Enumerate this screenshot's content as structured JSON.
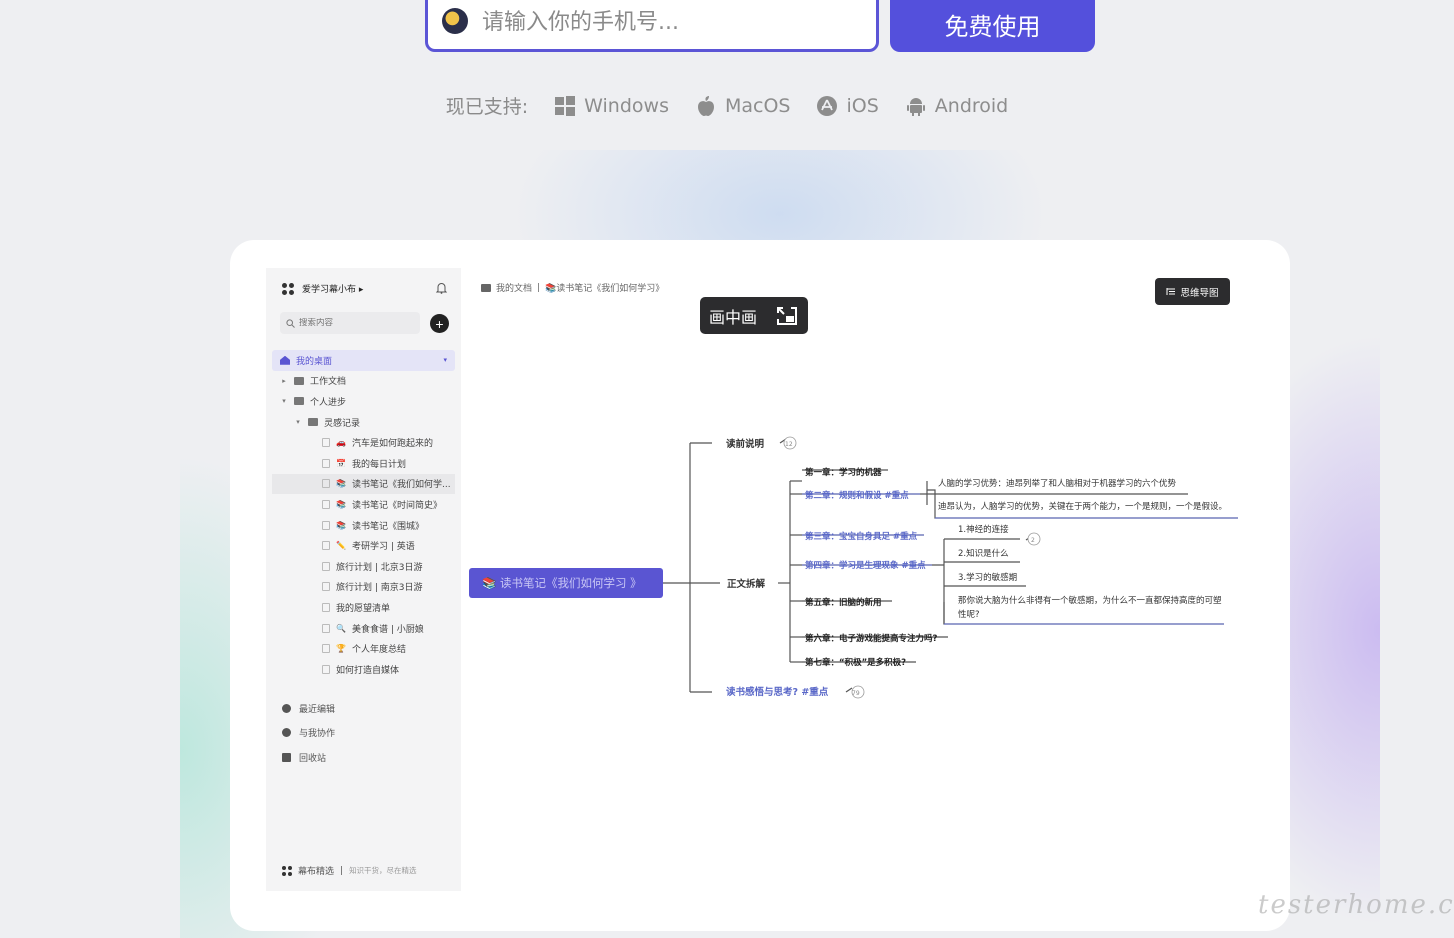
{
  "signup": {
    "phone_placeholder": "请输入你的手机号...",
    "cta_label": "免费使用"
  },
  "support": {
    "label": "现已支持:",
    "platforms": [
      "Windows",
      "MacOS",
      "iOS",
      "Android"
    ]
  },
  "app": {
    "workspace_name": "爱学习幕小布 ▸",
    "search_placeholder": "搜索内容",
    "tree": [
      {
        "label": "我的桌面",
        "level": 0,
        "kind": "home",
        "active": true
      },
      {
        "label": "工作文档",
        "level": 1,
        "kind": "folder",
        "caret": "▸"
      },
      {
        "label": "个人进步",
        "level": 1,
        "kind": "folder",
        "caret": "▾"
      },
      {
        "label": "灵感记录",
        "level": 2,
        "kind": "folder",
        "caret": "▾"
      },
      {
        "label": "汽车是如何跑起来的",
        "level": 3,
        "kind": "doc",
        "emoji": "🚗"
      },
      {
        "label": "我的每日计划",
        "level": 3,
        "kind": "doc",
        "emoji": "📅"
      },
      {
        "label": "读书笔记《我们如何学...",
        "level": 3,
        "kind": "doc",
        "emoji": "📚",
        "hover": true
      },
      {
        "label": "读书笔记《时间简史》",
        "level": 3,
        "kind": "doc",
        "emoji": "📚"
      },
      {
        "label": "读书笔记《围城》",
        "level": 3,
        "kind": "doc",
        "emoji": "📚"
      },
      {
        "label": "考研学习 | 英语",
        "level": 3,
        "kind": "doc",
        "emoji": "✏️"
      },
      {
        "label": "旅行计划 | 北京3日游",
        "level": 3,
        "kind": "doc"
      },
      {
        "label": "旅行计划 | 南京3日游",
        "level": 3,
        "kind": "doc"
      },
      {
        "label": "我的愿望清单",
        "level": 3,
        "kind": "doc"
      },
      {
        "label": "美食食谱 | 小厨娘",
        "level": 3,
        "kind": "doc",
        "emoji": "🔍"
      },
      {
        "label": "个人年度总结",
        "level": 3,
        "kind": "doc",
        "emoji": "🏆"
      },
      {
        "label": "如何打造自媒体",
        "level": 3,
        "kind": "doc"
      }
    ],
    "links": [
      "最近编辑",
      "与我协作",
      "回收站"
    ],
    "footer_brand": "幕布精选",
    "footer_slogan": "知识干货，尽在精选",
    "breadcrumb_root": "我的文档",
    "breadcrumb_doc": "📚读书笔记《我们如何学习》",
    "mindmap_button": "思维导图",
    "pip_label": "画中画",
    "mindmap": {
      "root": "📚 读书笔记《我们如何学习 》",
      "branch_intro": "读前说明",
      "branch_intro_count": "12",
      "branch_main": "正文拆解",
      "branch_reflect": "读书感悟与思考? #重点",
      "branch_reflect_count": "79",
      "ch1": "第一章：学习的机器",
      "ch2": "第二章：规则和假设 #重点",
      "ch2_a": "人脑的学习优势：迪昂列举了和人脑相对于机器学习的六个优势",
      "ch2_b": "迪昂认为，人脑学习的优势，关键在于两个能力，一个是规则，一个是假设。",
      "ch3": "第三章：宝宝自身具足 #重点",
      "ch4": "第四章：学习是生理现象 #重点",
      "ch4_a": "1.神经的连接",
      "ch4_a_count": "2",
      "ch4_b": "2.知识是什么",
      "ch4_c": "3.学习的敏感期",
      "ch4_d1": "那你说大脑为什么非得有一个敏感期，为什么不一直都保持高度的可塑",
      "ch4_d2": "性呢?",
      "ch5": "第五章：旧脑的新用",
      "ch6": "第六章：电子游戏能提高专注力吗?",
      "ch7": "第七章：“积极”是多积极?"
    }
  },
  "watermark": "testerhome.com",
  "colors": {
    "accent": "#5450dc",
    "dark": "#2c2c2e",
    "link_blue": "#5a68c8"
  }
}
